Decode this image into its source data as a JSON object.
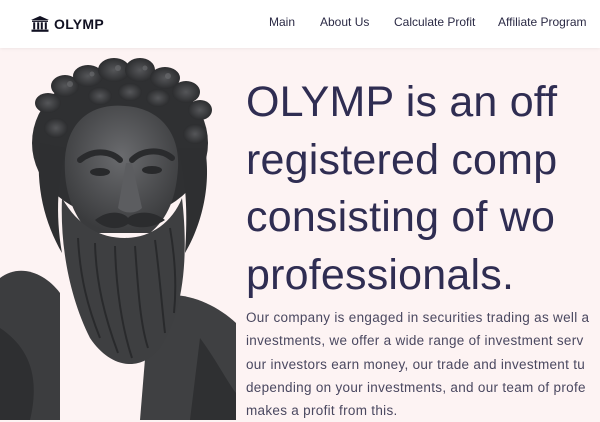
{
  "header": {
    "logo_icon": "temple-icon",
    "logo_text": "OLYMP",
    "nav": [
      {
        "label": "Main"
      },
      {
        "label": "About Us"
      },
      {
        "label": "Calculate Profit"
      },
      {
        "label": "Affiliate Program"
      }
    ]
  },
  "hero": {
    "image": "zeus-statue-bust",
    "headline_lines": [
      "OLYMP is an off",
      "registered comp",
      "consisting of wo",
      "professionals."
    ],
    "description_lines": [
      "Our company is engaged in securities trading as well a",
      "investments, we offer a wide range of investment serv",
      "our investors earn money, our trade and investment tu",
      "depending on your investments, and our team of profe",
      "makes a profit from this."
    ]
  },
  "colors": {
    "page_background": "#fdf3f3",
    "header_background": "#ffffff",
    "headline": "#2f2d52",
    "body_text": "#4a4860",
    "statue": "#4a4b4d"
  }
}
